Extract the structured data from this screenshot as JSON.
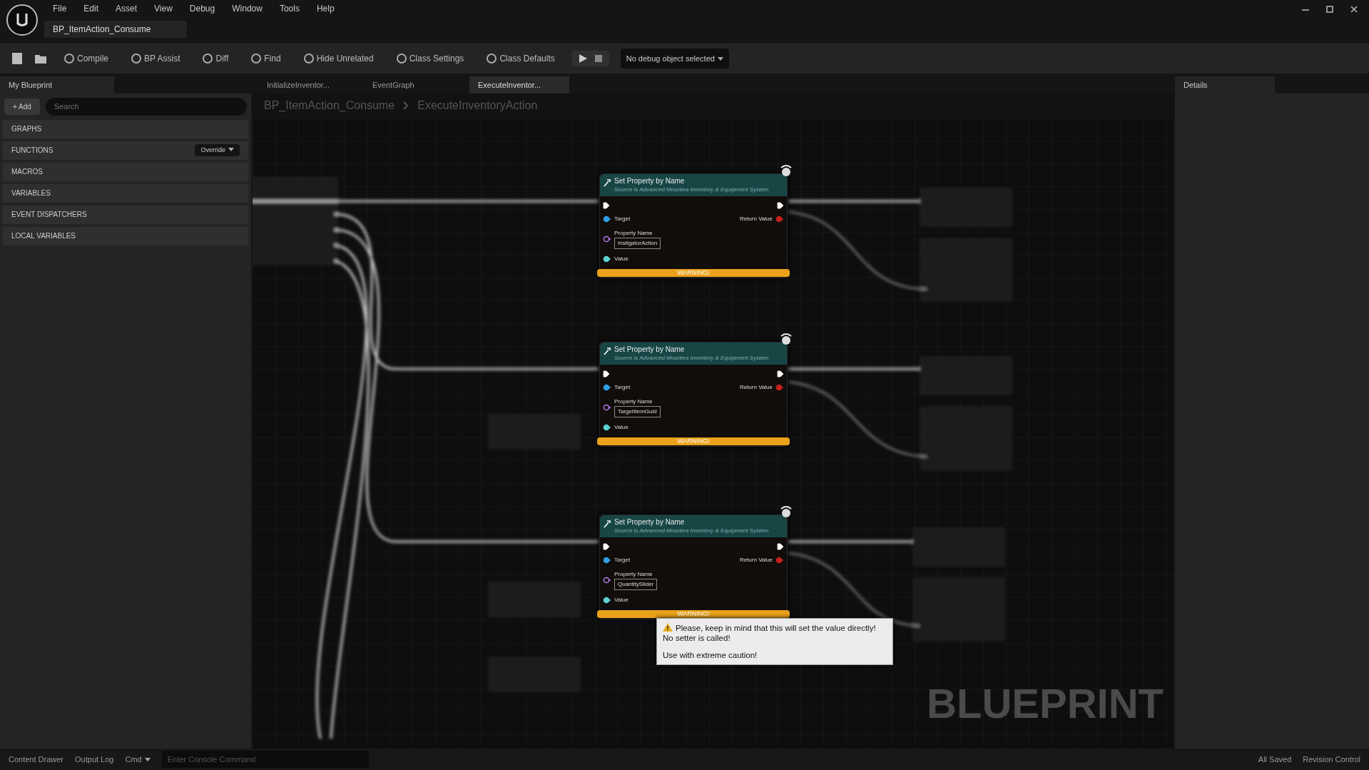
{
  "menu": [
    "File",
    "Edit",
    "Asset",
    "View",
    "Debug",
    "Window",
    "Tools",
    "Help"
  ],
  "document_tab": {
    "title": "BP_ItemAction_Consume"
  },
  "toolbar": {
    "buttons": [
      {
        "label": "Compile"
      },
      {
        "label": "BP Assist"
      },
      {
        "label": "Diff"
      },
      {
        "label": "Find"
      },
      {
        "label": "Hide Unrelated"
      },
      {
        "label": "Class Settings"
      },
      {
        "label": "Class Defaults"
      }
    ],
    "debug_dropdown": "No debug object selected"
  },
  "my_blueprint": {
    "title": "My Blueprint",
    "add_button": "+ Add",
    "search": {
      "placeholder": "Search"
    },
    "sections": [
      {
        "label": "GRAPHS"
      },
      {
        "label": "FUNCTIONS"
      },
      {
        "label": "MACROS"
      },
      {
        "label": "VARIABLES"
      },
      {
        "label": "EVENT DISPATCHERS"
      },
      {
        "label": "LOCAL VARIABLES"
      }
    ],
    "override_button": "Override"
  },
  "graph_tabs": [
    {
      "label": "InitializeInventor...",
      "selected": false
    },
    {
      "label": "EventGraph",
      "selected": false
    },
    {
      "label": "ExecuteInventor...",
      "selected": true
    }
  ],
  "breadcrumb": [
    "BP_ItemAction_Consume",
    "ExecuteInventoryAction"
  ],
  "nodes": [
    {
      "title": "Set Property by Name",
      "subtitle": "Source is Advanced Mountea Inventory & Equipment System",
      "target": "Target",
      "return_value": "Return Value",
      "property_label": "Property Name",
      "property_name": "InstigatorAction",
      "value": "Value",
      "warning": "WARNING!"
    },
    {
      "title": "Set Property by Name",
      "subtitle": "Source is Advanced Mountea Inventory & Equipment System",
      "target": "Target",
      "return_value": "Return Value",
      "property_label": "Property Name",
      "property_name": "TargetItemGuid",
      "value": "Value",
      "warning": "WARNING!"
    },
    {
      "title": "Set Property by Name",
      "subtitle": "Source is Advanced Mountea Inventory & Equipment System",
      "target": "Target",
      "return_value": "Return Value",
      "property_label": "Property Name",
      "property_name": "QuantitySlider",
      "value": "Value",
      "warning": "WARNING!"
    }
  ],
  "tooltip": {
    "lines": [
      "Please, keep in mind that this will set the value directly!",
      "No setter is called!",
      "Use with extreme caution!"
    ]
  },
  "graph_label": "BLUEPRINT",
  "details": {
    "title": "Details"
  },
  "status_bar": {
    "left": [
      "Content Drawer",
      "Output Log"
    ],
    "cmd": "Cmd",
    "console": {
      "placeholder": "Enter Console Command"
    },
    "right": [
      "All Saved",
      "Revision Control"
    ]
  }
}
